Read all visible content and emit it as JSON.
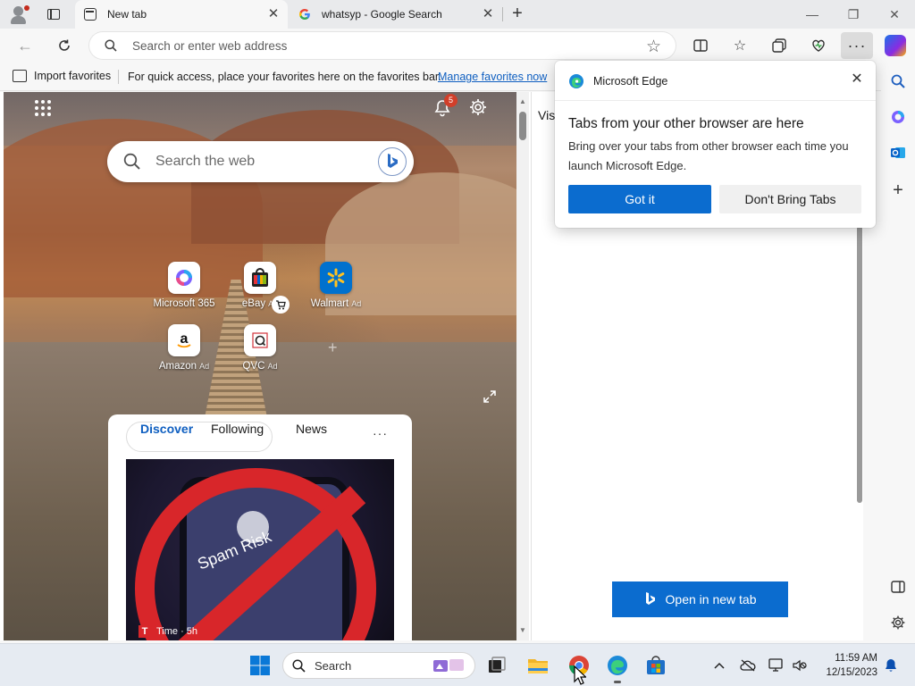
{
  "browser": {
    "tabs": [
      {
        "title": "New tab",
        "active": true
      },
      {
        "title": "whatsyp - Google Search",
        "active": false
      }
    ],
    "address_bar": {
      "placeholder": "Search or enter web address",
      "value": ""
    },
    "favorites_bar": {
      "import_label": "Import favorites",
      "message": "For quick access, place your favorites here on the favorites bar.",
      "manage_link": "Manage favorites now"
    },
    "accent_color": "#0b6ccf"
  },
  "new_tab_page": {
    "notification_count": "5",
    "search": {
      "placeholder": "Search the web"
    },
    "quick_links": [
      {
        "name": "Microsoft 365",
        "ad": ""
      },
      {
        "name": "eBay",
        "ad": "Ad"
      },
      {
        "name": "Walmart",
        "ad": "Ad"
      },
      {
        "name": "Amazon",
        "ad": "Ad"
      },
      {
        "name": "QVC",
        "ad": "Ad"
      }
    ],
    "feed": {
      "tabs": [
        "Discover",
        "Following",
        "News"
      ],
      "active_tab": "Discover",
      "more": "···",
      "card": {
        "image_text": "Spam Risk",
        "source": "Time · 5h",
        "source_logo": "T"
      }
    }
  },
  "right_pane": {
    "heading_partial": "Vis",
    "open_button": "Open in new tab"
  },
  "popup": {
    "app_name": "Microsoft Edge",
    "title": "Tabs from your other browser are here",
    "body": "Bring over your tabs from other browser each time you launch Microsoft Edge.",
    "primary_button": "Got it",
    "secondary_button": "Don't Bring Tabs"
  },
  "taskbar": {
    "search_label": "Search",
    "time": "11:59 AM",
    "date": "12/15/2023"
  }
}
